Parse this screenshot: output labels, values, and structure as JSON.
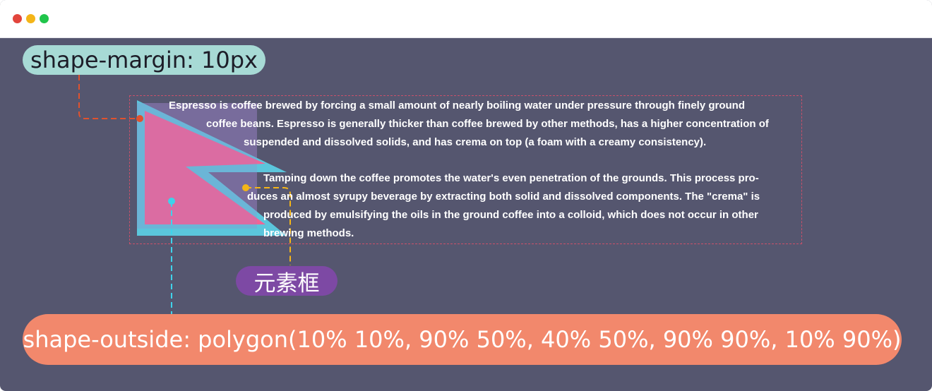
{
  "window": {
    "buttons": [
      "close",
      "minimize",
      "maximize"
    ]
  },
  "labels": {
    "shape_margin": "shape-margin: 10px",
    "element_box": "元素框",
    "shape_outside": "shape-outside: polygon(10% 10%, 90% 50%, 40% 50%, 90% 90%, 10% 90%)"
  },
  "paragraphs": [
    {
      "lines": [
        "Espresso is coffee brewed by forcing a small amount of nearly boiling water under pressure through finely ground",
        "coffee beans. Espresso is generally thicker than coffee brewed by other methods, has a higher concentration of",
        "suspended and dissolved solids, and has crema on top (a foam with a creamy consistency)."
      ]
    },
    {
      "lines": [
        "Tamping down the coffee promotes the water's even penetration of the grounds. This process pro-",
        "duces an almost syrupy beverage by extracting both solid and dissolved components. The \"crema\" is",
        "produced by emulsifying the oils in the ground coffee into a colloid, which does not occur in other",
        "brewing methods."
      ]
    }
  ],
  "colors": {
    "background": "#55566f",
    "shape_fill": "#f06596",
    "shape_margin": "#5bc6dc",
    "element_box": "#9b82c8",
    "margin_callout": "#e0522e",
    "box_callout": "#f4b518",
    "outside_callout": "#3fd2ea"
  }
}
